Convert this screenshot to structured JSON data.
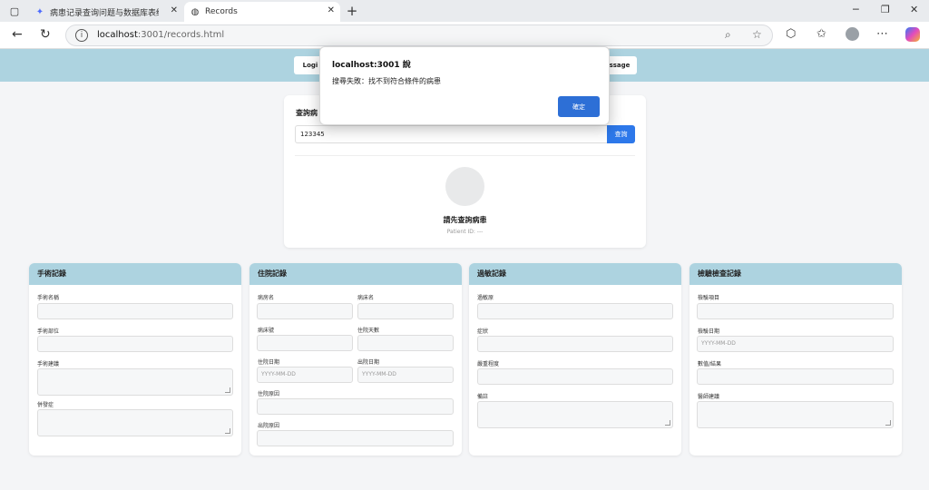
{
  "browser": {
    "tabs": [
      {
        "label": "病患记录查询问题与数据库表结构"
      },
      {
        "label": "Records"
      }
    ],
    "url_host": "localhost",
    "url_rest": ":3001/records.html"
  },
  "header": {
    "nav_login": "Logi",
    "nav_message": "ssage"
  },
  "query": {
    "title": "查詢病",
    "input_value": "123345",
    "button_label": "查詢",
    "patient_name": "請先查詢病患",
    "patient_id": "Patient ID: ---"
  },
  "surgery": {
    "title": "手術記錄",
    "name_label": "手術名稱",
    "site_label": "手術部位",
    "advice_label": "手術建議",
    "complication_label": "併發症"
  },
  "admission": {
    "title": "住院記錄",
    "ward_label": "病房名",
    "bed_label": "病床名",
    "bed_no_label": "病床號",
    "days_label": "住院天數",
    "admit_date_label": "住院日期",
    "discharge_date_label": "出院日期",
    "date_placeholder": "YYYY-MM-DD",
    "admit_reason_label": "住院原因",
    "discharge_reason_label": "出院原因"
  },
  "allergy": {
    "title": "過敏記錄",
    "allergen_label": "過敏原",
    "symptom_label": "症狀",
    "severity_label": "嚴重程度",
    "note_label": "備註"
  },
  "lab": {
    "title": "檢驗檢查記錄",
    "item_label": "檢驗項目",
    "date_label": "檢驗日期",
    "date_placeholder": "YYYY-MM-DD",
    "value_label": "數值/結果",
    "advice_label": "醫師建議"
  },
  "dialog": {
    "title": "localhost:3001 說",
    "message": "搜尋失敗：找不到符合條件的病患",
    "ok_label": "確定"
  },
  "colors": {
    "header_bg": "#add3e0",
    "primary": "#2d78ea"
  }
}
